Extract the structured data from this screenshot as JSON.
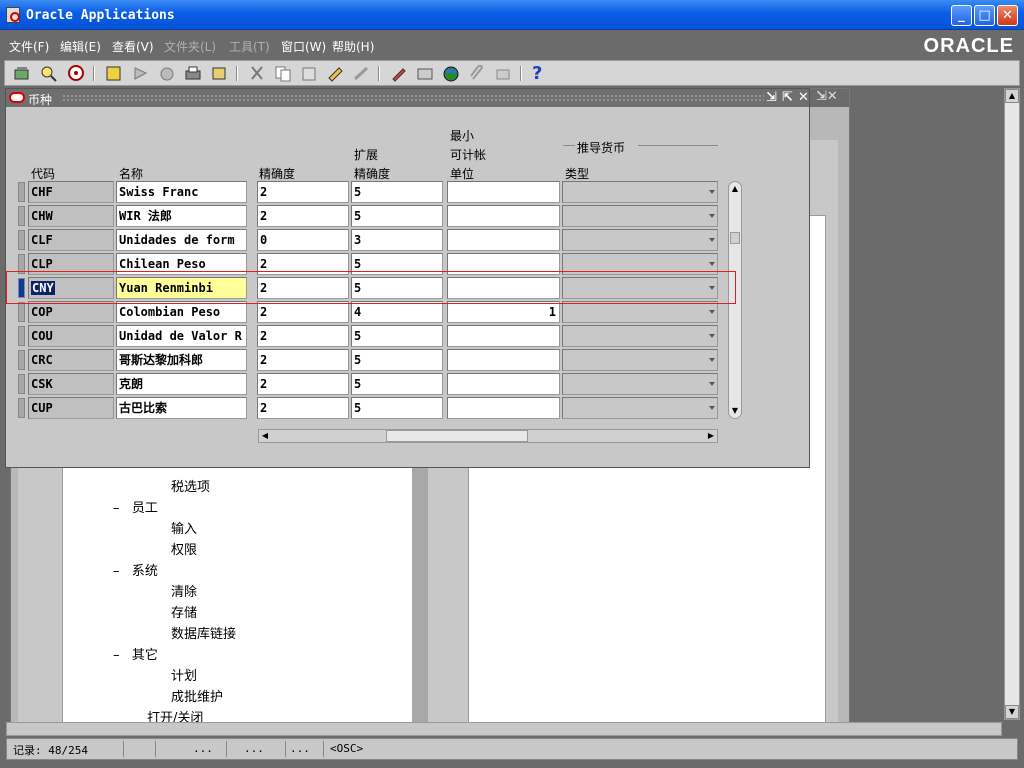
{
  "window": {
    "title": "Oracle Applications",
    "minimize": "_",
    "maximize": "□",
    "close": "✕"
  },
  "menu": [
    {
      "label": "文件(F)",
      "enabled": true
    },
    {
      "label": "编辑(E)",
      "enabled": true
    },
    {
      "label": "查看(V)",
      "enabled": true
    },
    {
      "label": "文件夹(L)",
      "enabled": false
    },
    {
      "label": "工具(T)",
      "enabled": false
    },
    {
      "label": "窗口(W)",
      "enabled": true
    },
    {
      "label": "帮助(H)",
      "enabled": true
    }
  ],
  "brand": "ORACLE",
  "toolbar": {
    "help_glyph": "?"
  },
  "form": {
    "title": "币种",
    "headers": {
      "code": "代码",
      "name": "名称",
      "precision": "精确度",
      "ext_line1": "扩展",
      "ext_line2": "精确度",
      "mau_line1": "最小",
      "mau_line2": "可计帐",
      "mau_line3": "单位",
      "group": "推导货币",
      "type": "类型"
    },
    "rows": [
      {
        "code": "CHF",
        "name": "Swiss Franc",
        "precision": "2",
        "ext": "5",
        "mau": ""
      },
      {
        "code": "CHW",
        "name": "WIR 法郎",
        "precision": "2",
        "ext": "5",
        "mau": ""
      },
      {
        "code": "CLF",
        "name": "Unidades de form",
        "precision": "0",
        "ext": "3",
        "mau": ""
      },
      {
        "code": "CLP",
        "name": "Chilean Peso",
        "precision": "2",
        "ext": "5",
        "mau": ""
      },
      {
        "code": "CNY",
        "name": "Yuan Renminbi",
        "precision": "2",
        "ext": "5",
        "mau": ""
      },
      {
        "code": "COP",
        "name": "Colombian Peso",
        "precision": "2",
        "ext": "4",
        "mau": "1"
      },
      {
        "code": "COU",
        "name": "Unidad de Valor R",
        "precision": "2",
        "ext": "5",
        "mau": ""
      },
      {
        "code": "CRC",
        "name": "哥斯达黎加科郎",
        "precision": "2",
        "ext": "5",
        "mau": ""
      },
      {
        "code": "CSK",
        "name": "克朗",
        "precision": "2",
        "ext": "5",
        "mau": ""
      },
      {
        "code": "CUP",
        "name": "古巴比索",
        "precision": "2",
        "ext": "5",
        "mau": ""
      }
    ]
  },
  "tree": {
    "items": [
      {
        "label": "税选项",
        "prefix": ""
      },
      {
        "label": "员工",
        "prefix": "–"
      },
      {
        "label": "输入",
        "prefix": ""
      },
      {
        "label": "权限",
        "prefix": ""
      },
      {
        "label": "系统",
        "prefix": "–"
      },
      {
        "label": "清除",
        "prefix": ""
      },
      {
        "label": "存储",
        "prefix": ""
      },
      {
        "label": "数据库链接",
        "prefix": ""
      },
      {
        "label": "其它",
        "prefix": "–"
      },
      {
        "label": "计划",
        "prefix": ""
      },
      {
        "label": "成批维护",
        "prefix": ""
      },
      {
        "label": "打开/关闭",
        "prefix": ""
      }
    ]
  },
  "status": {
    "record": "记录: 48/254",
    "seg3": "...",
    "seg4": "...",
    "seg5": "...",
    "mode": "<OSC>"
  }
}
